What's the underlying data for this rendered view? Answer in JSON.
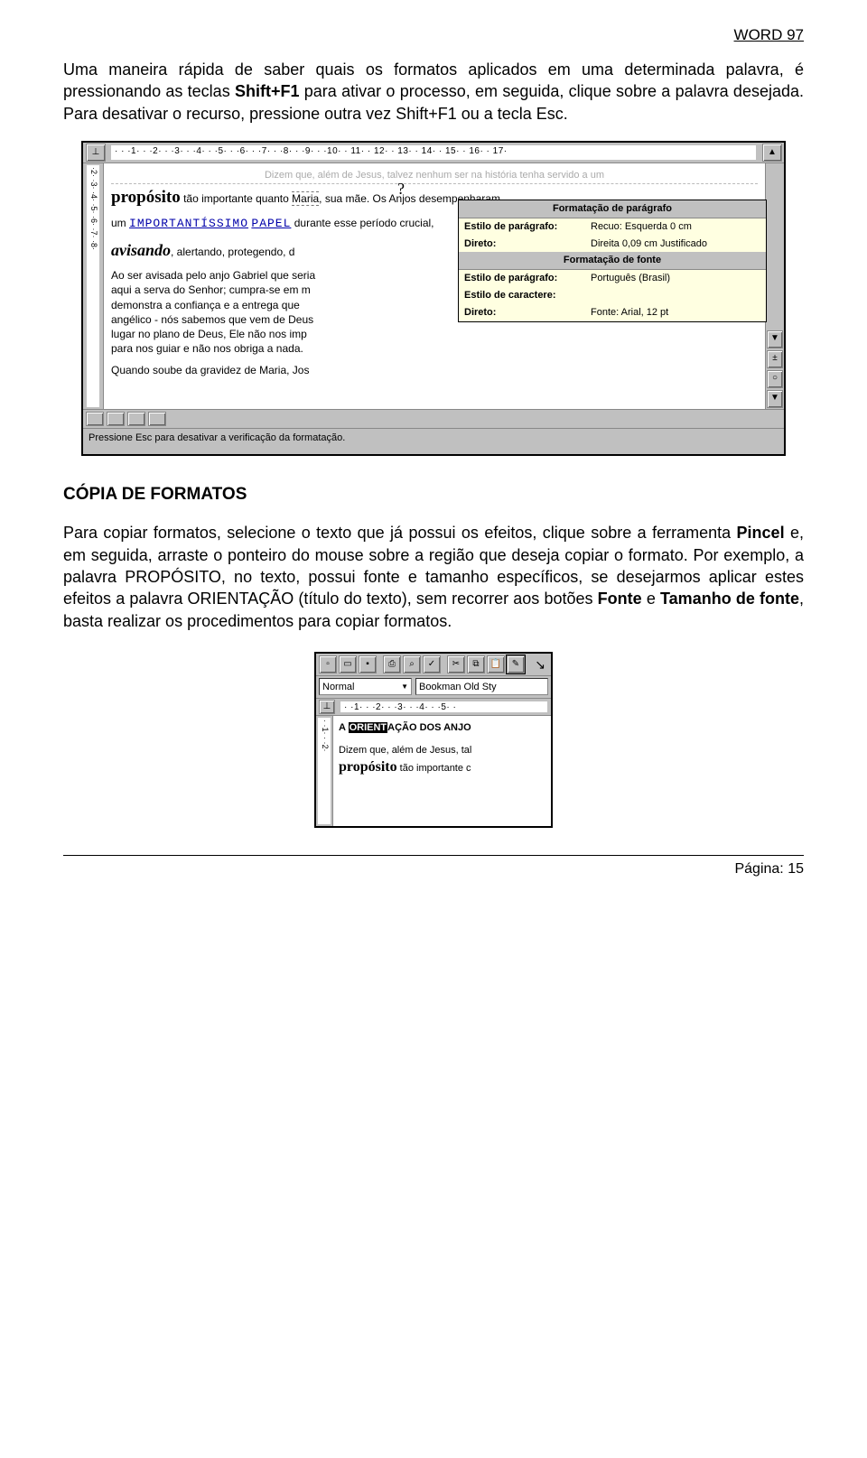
{
  "header": "WORD 97",
  "p1a": "Uma maneira rápida de saber quais os formatos aplicados em uma determinada palavra, é pressionando as teclas ",
  "p1b": "Shift+F1",
  "p1c": " para ativar o processo, em seguida, clique sobre a palavra desejada. Para desativar o recurso, pressione outra vez Shift+F1 ou a tecla Esc.",
  "fig1": {
    "ruler_ticks": "· · ·1· · ·2· · ·3· · ·4· · ·5· · ·6· · ·7· · ·8· · ·9· · ·10· · 11· · 12· · 13· · 14· · 15· · 16· · 17·",
    "vruler": "·2· ·3· ·4· ·5· ·6· ·7· ·8·",
    "cursor": "?",
    "line_top": "Dizem que, além de Jesus, talvez nenhum ser na história tenha servido a um",
    "l2a": "propósito",
    "l2b": " tão importante quanto ",
    "l2c": "Maria",
    "l2d": ", sua mãe. Os Anjos desempenharam",
    "l3a": "um    ",
    "l3b": "IMPORTANTÍSSIMO",
    "l3c": "   ",
    "l3d": "PAPEL",
    "l3e": "   durante    esse    período    crucial,",
    "l4a": "avisando",
    "l4b": ", alertando, protegendo, d",
    "l5": "Ao ser avisada pelo anjo Gabriel que seria",
    "l5b": "aqui a serva do Senhor; cumpra-se em m",
    "l5c": "demonstra a confiança e a entrega que",
    "l5d": "angélico - nós sabemos que vem de Deus",
    "l5e": "lugar no plano de Deus, Ele não nos imp",
    "l5f": "para nos guiar e não nos obriga a nada.",
    "l6": "Quando soube da gravidez de Maria, Jos",
    "popup": {
      "t1": "Formatação de parágrafo",
      "r1l": "Estilo de parágrafo:",
      "r1v": "Recuo:  Esquerda  0 cm",
      "r2l": "Direto:",
      "r2v": "Direita  0,09 cm Justificado",
      "t2": "Formatação de fonte",
      "r3l": "Estilo de parágrafo:",
      "r3v": "Português (Brasil)",
      "r4l": "Estilo de caractere:",
      "r4v": "",
      "r5l": "Direto:",
      "r5v": "Fonte: Arial, 12 pt"
    },
    "sbtns": {
      "up": "▲",
      "d1": "±",
      "d2": "○",
      "dn": "▼"
    },
    "status": "Pressione Esc para desativar a verificação da formatação."
  },
  "h2": "CÓPIA DE FORMATOS",
  "p2a": "Para copiar formatos, selecione o texto que já possui os efeitos, clique sobre a ferramenta ",
  "p2b": "Pincel",
  "p2c": " e, em seguida, arraste o ponteiro do mouse sobre a região que deseja copiar o formato. Por exemplo, a palavra PROPÓSITO, no texto, possui fonte e tamanho específicos, se desejarmos aplicar estes efeitos a palavra ORIENTAÇÃO (título do texto), sem recorrer aos botões ",
  "p2d": "Fonte",
  "p2e": " e ",
  "p2f": "Tamanho de fonte",
  "p2g": ", basta realizar os procedimentos para copiar formatos.",
  "fig2": {
    "icons": {
      "new": "▫",
      "open": "▭",
      "save": "▪",
      "print": "⎙",
      "preview": "⌕",
      "spell": "✓",
      "cut": "✂",
      "copy": "⧉",
      "paste": "📋",
      "brush": "✎"
    },
    "style": "Normal",
    "font": "Bookman Old Sty",
    "ruler": "· ·1· · ·2· · ·3· · ·4· · ·5· ·",
    "vruler": "· ·1· · ·2·",
    "la": "A ",
    "lsel": "ORIENT",
    "lb": "AÇÃO DOS ANJO",
    "l2": "Dizem que, além de Jesus, tal",
    "l3a": "propósito",
    "l3b": " tão importante c"
  },
  "footer": "Página:  15"
}
